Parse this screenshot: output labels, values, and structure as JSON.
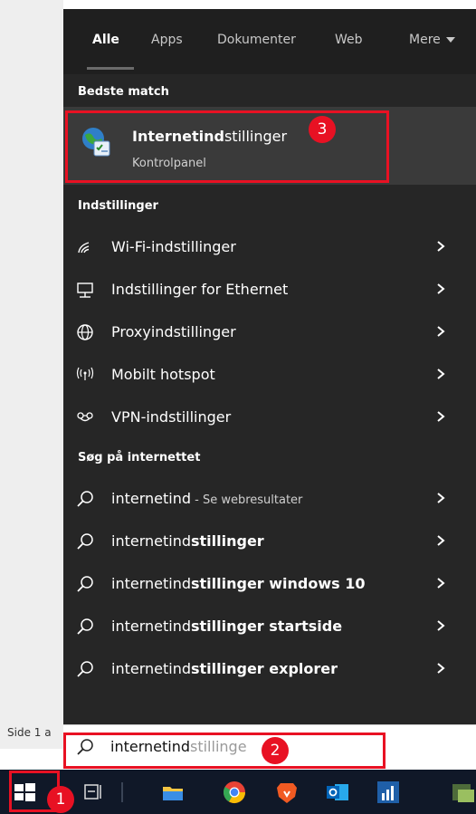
{
  "tabs": [
    "Alle",
    "Apps",
    "Dokumenter",
    "Web",
    "Mere"
  ],
  "best_match": {
    "header": "Bedste match",
    "title_bold": "Internetind",
    "title_rest": "stillinger",
    "subtitle": "Kontrolpanel",
    "badge": "3"
  },
  "settings": {
    "header": "Indstillinger",
    "items": [
      {
        "label": "Wi-Fi-indstillinger",
        "icon": "wifi-icon"
      },
      {
        "label": "Indstillinger for Ethernet",
        "icon": "ethernet-icon"
      },
      {
        "label": "Proxyindstillinger",
        "icon": "globe-icon"
      },
      {
        "label": "Mobilt hotspot",
        "icon": "hotspot-icon"
      },
      {
        "label": "VPN-indstillinger",
        "icon": "vpn-icon"
      }
    ]
  },
  "web": {
    "header": "Søg på internettet",
    "first": {
      "query": "internetind",
      "suffix": " - Se webresultater"
    },
    "items": [
      {
        "prefix": "internetind",
        "bold": "stillinger"
      },
      {
        "prefix": "internetind",
        "bold": "stillinger windows 10"
      },
      {
        "prefix": "internetind",
        "bold": "stillinger startside"
      },
      {
        "prefix": "internetind",
        "bold": "stillinger explorer"
      }
    ]
  },
  "search": {
    "typed": "internetind",
    "hint": "stillinge",
    "badge": "2"
  },
  "background": {
    "side_label": "Side 1 a"
  },
  "taskbar": {
    "badge": "1",
    "icons": [
      "windows-start-icon",
      "task-view-icon",
      "file-explorer-icon",
      "chrome-icon",
      "brave-icon",
      "outlook-icon",
      "stock-chart-icon",
      "app-icon"
    ]
  },
  "colors": {
    "panel": "#262626",
    "highlight": "#3a3a3a",
    "annotation_red": "#e81123",
    "taskbar": "#101828"
  }
}
